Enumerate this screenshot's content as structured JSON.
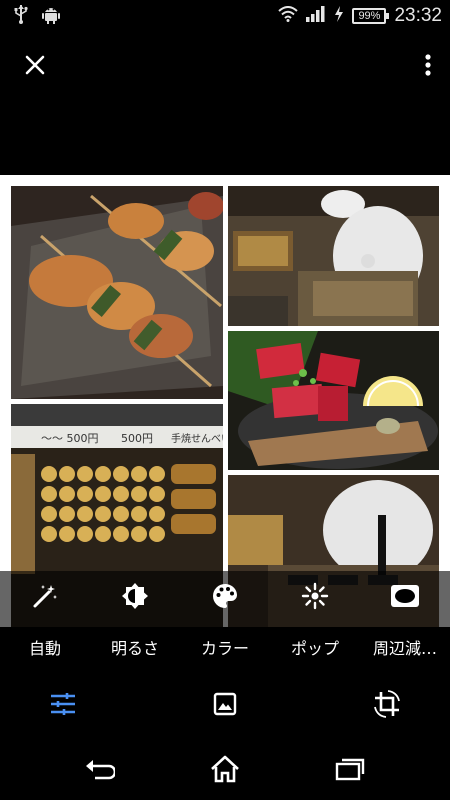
{
  "status_bar": {
    "time": "23:32",
    "battery": "99%",
    "icons": [
      "usb-icon",
      "android-icon",
      "wifi-icon",
      "signal-icon",
      "charging-icon",
      "battery-icon"
    ]
  },
  "top_bar": {
    "close_icon": "close-icon",
    "menu_icon": "more-vert-icon"
  },
  "photo": {
    "subject": "Collage of yakitori skewers, chefs, tuna sashimi and shop display",
    "visible_signs": [
      "500円",
      "500円",
      "手焼せんべい"
    ]
  },
  "tools": [
    {
      "icon": "auto-wand-icon",
      "label": "自動"
    },
    {
      "icon": "brightness-icon",
      "label": "明るさ"
    },
    {
      "icon": "palette-icon",
      "label": "カラー"
    },
    {
      "icon": "pop-icon",
      "label": "ポップ"
    },
    {
      "icon": "vignette-icon",
      "label": "周辺減…"
    }
  ],
  "edit_tabs": [
    {
      "icon": "tune-sliders-icon",
      "active": true
    },
    {
      "icon": "image-filters-icon",
      "active": false
    },
    {
      "icon": "crop-rotate-icon",
      "active": false
    }
  ],
  "nav_bar": {
    "icons": [
      "back-icon",
      "home-icon",
      "recents-icon"
    ]
  },
  "colors": {
    "accent": "#4a90f2",
    "background": "#000000",
    "toolbar_overlay": "rgba(0,0,0,0.6)"
  }
}
